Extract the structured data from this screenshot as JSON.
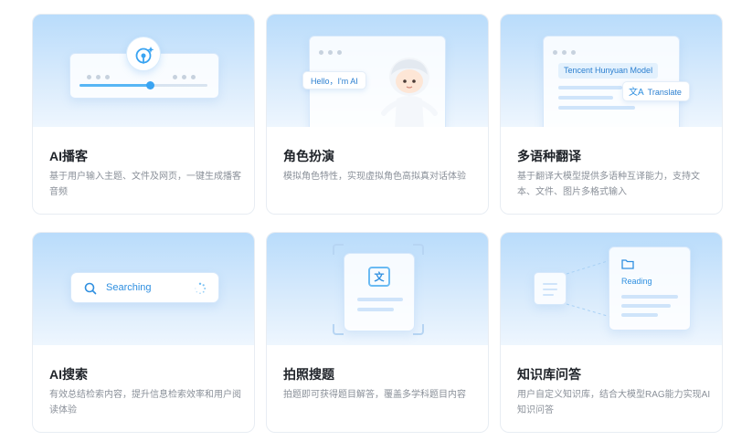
{
  "cards": [
    {
      "title": "AI播客",
      "description": "基于用户输入主题、文件及网页，一键生成播客音频",
      "icon": "podcast-icon"
    },
    {
      "title": "角色扮演",
      "description": "模拟角色特性，实现虚拟角色高拟真对话体验",
      "bubble": "Hello，I'm AI",
      "icon": "character-avatar"
    },
    {
      "title": "多语种翻译",
      "description": "基于翻译大模型提供多语种互译能力，支持文本、文件、图片多格式输入",
      "model_tag": "Tencent Hunyuan Model",
      "translate_label": "Translate",
      "icon": "translate-icon"
    },
    {
      "title": "AI搜索",
      "description": "有效总结检索内容，提升信息检索效率和用户阅读体验",
      "search_label": "Searching",
      "icon": "search-icon"
    },
    {
      "title": "拍照搜题",
      "description": "拍题即可获得题目解答，覆盖多学科题目内容",
      "icon_glyph": "文",
      "icon": "text-scan-icon"
    },
    {
      "title": "知识库问答",
      "description": "用户自定义知识库，结合大模型RAG能力实现AI知识问答",
      "reading_label": "Reading",
      "icon": "document-icon"
    }
  ],
  "colors": {
    "accent": "#2f8fe0",
    "hero_top": "#b9dcfb",
    "title": "#1f2329",
    "desc": "#8a9099"
  },
  "podcast_slider_value": 0.55
}
